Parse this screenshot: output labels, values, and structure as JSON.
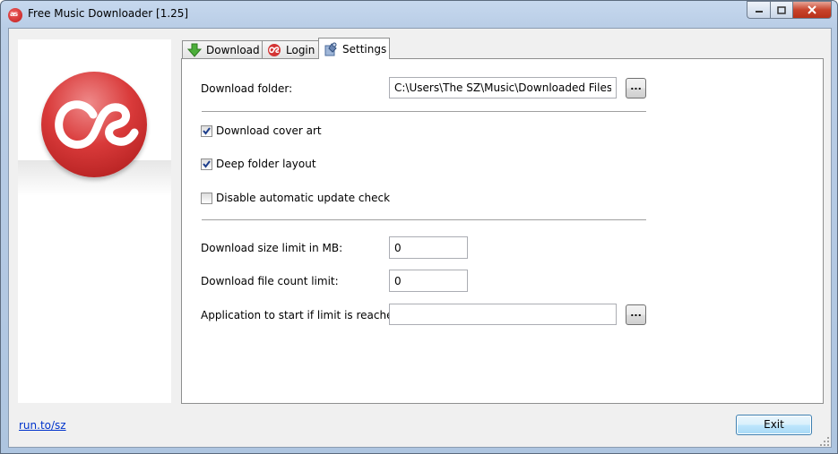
{
  "window": {
    "title": "Free Music Downloader [1.25]"
  },
  "tabs": [
    {
      "label": "Download",
      "icon": "download-arrow-icon"
    },
    {
      "label": "Login",
      "icon": "lastfm-icon"
    },
    {
      "label": "Settings",
      "icon": "settings-icon"
    }
  ],
  "settings": {
    "download_folder_label": "Download folder:",
    "download_folder_value": "C:\\Users\\The SZ\\Music\\Downloaded Files\\",
    "browse_label": "...",
    "cover_art_label": "Download cover art",
    "cover_art_checked": true,
    "deep_folder_label": "Deep folder layout",
    "deep_folder_checked": true,
    "disable_update_label": "Disable automatic update check",
    "disable_update_checked": false,
    "size_limit_label": "Download size limit in MB:",
    "size_limit_value": "0",
    "count_limit_label": "Download file count limit:",
    "count_limit_value": "0",
    "app_start_label": "Application to start if limit is reached:",
    "app_start_value": ""
  },
  "footer": {
    "link_text": "run.to/sz",
    "exit_label": "Exit"
  },
  "colors": {
    "accent_red": "#d33434",
    "link_blue": "#0033cc",
    "button_blue": "#3c7fb1"
  }
}
